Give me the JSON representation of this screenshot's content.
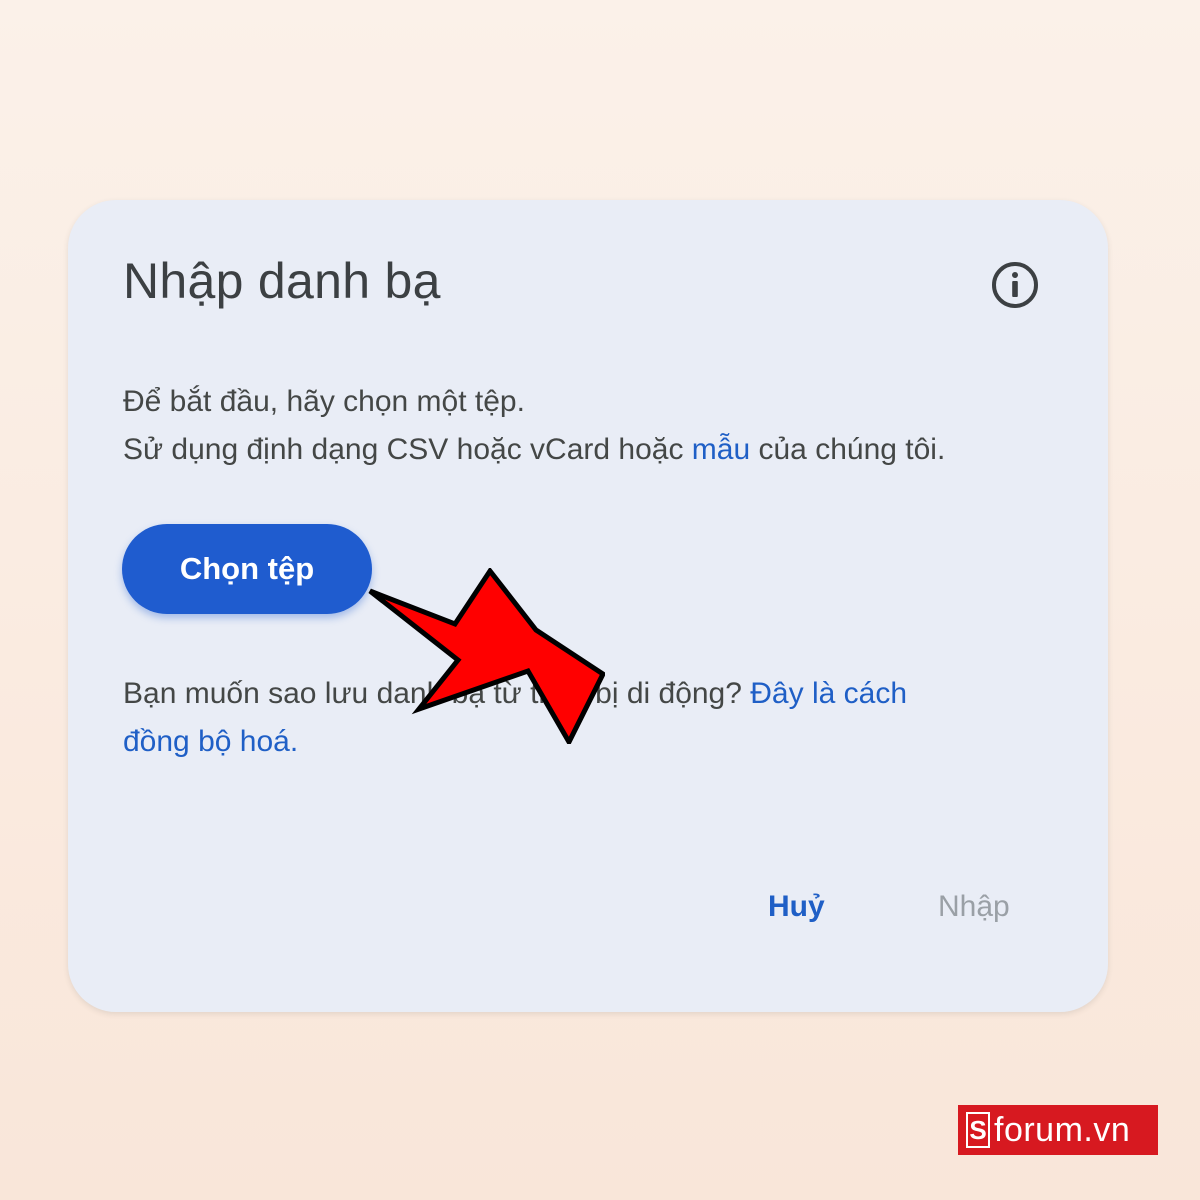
{
  "dialog": {
    "title": "Nhập danh bạ",
    "info_icon": "info-icon",
    "description_line1": "Để bắt đầu, hãy chọn một tệp.",
    "description_line2_prefix": "Sử dụng định dạng CSV hoặc vCard hoặc ",
    "description_line2_link": "mẫu",
    "description_line2_suffix": " của chúng tôi.",
    "choose_file_label": "Chọn tệp",
    "sync_text_line1": "Bạn muốn sao lưu danh bạ từ thiết bị di động? ",
    "sync_link_part1": "Đây là cách",
    "sync_link_part2": "đồng bộ hoá.",
    "cancel_label": "Huỷ",
    "import_label": "Nhập"
  },
  "annotation": {
    "arrow_icon": "red-arrow-icon",
    "arrow_color": "#ff0000"
  },
  "watermark": {
    "logo_letter": "S",
    "text": "forum.vn",
    "color": "#d71920"
  },
  "colors": {
    "background": "#fbf1e9",
    "dialog": "#e9edf6",
    "primary": "#1f5ccf",
    "link": "#1f5fc6",
    "disabled": "#9aa0a6"
  }
}
